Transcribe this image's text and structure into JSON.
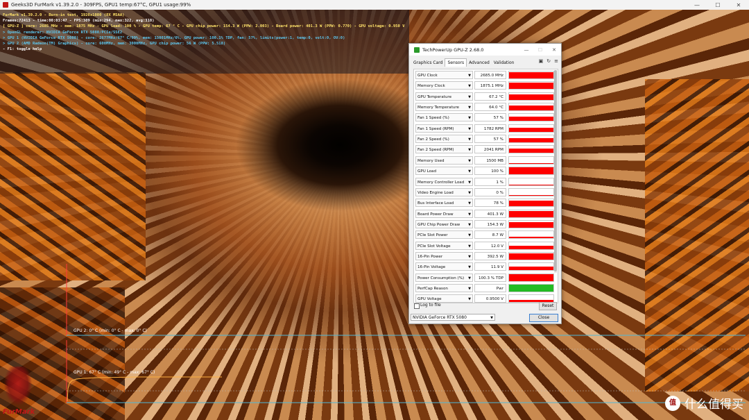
{
  "window": {
    "title": "Geeks3D FurMark v1.39.2.0 - 309FPS, GPU1 temp:67°C, GPU1 usage:99%",
    "min_glyph": "—",
    "max_glyph": "☐",
    "close_glyph": "✕"
  },
  "overlay": {
    "lines": [
      {
        "text": "FurMark v1.39.2.0 - Burn-in test, 1920x1080 (8X MSAA)",
        "color": "yellow"
      },
      {
        "text": "Frames:72413 - time:00:03:47 - FPS:309 (min:294, max:322, avg:318)",
        "color": "white"
      },
      {
        "text": "[ GPU-Z ] core: 2685 MHz - mem: 1875 MHz - GPU load: 100 % - GPU temp: 67 ° C - GPU chip power: 154.3 W (PPW: 2.003) - Board power: 401.3 W (PPW: 0.770) - GPU voltage: 0.950 V",
        "color": "yellow"
      },
      {
        "text": "> OpenGL renderer: NVIDIA GeForce RTX 5080/PCIe/SSE2",
        "color": "cyan"
      },
      {
        "text": "> GPU 1 (NVIDIA GeForce RTX 5080) - core: 2677MHz/67° C/99%, mem: 15001MHz/6%, GPU power: 100.1% TDP, fan: 57%, limits(power:1, temp:0, volt:0, OV:0)",
        "color": "cyan"
      },
      {
        "text": "> GPU 2 (AMD Radeon(TM) Graphics) - core: 600MHz, mem: 3000MHz, GPU chip power: 56 W (PPW: 5.518)",
        "color": "cyan"
      },
      {
        "text": "- F1: toggle help",
        "color": "white"
      }
    ]
  },
  "graphs": {
    "gpu2_label": "GPU 2: 0° C (min: 0° C - max: 0° C)",
    "gpu1_label": "GPU 1: 67° C (min: 49° C - max: 67° C)"
  },
  "gpuz": {
    "title": "TechPowerUp GPU-Z 2.68.0",
    "tabs": [
      "Graphics Card",
      "Sensors",
      "Advanced",
      "Validation"
    ],
    "active_tab": "Sensors",
    "icons": [
      "camera-icon",
      "refresh-icon",
      "menu-icon"
    ],
    "sensors": [
      {
        "name": "GPU Clock",
        "value": "2685.0 MHz",
        "fill": 0.85,
        "color": "#ff0000"
      },
      {
        "name": "Memory Clock",
        "value": "1875.1 MHz",
        "fill": 0.85,
        "color": "#ff0000"
      },
      {
        "name": "GPU Temperature",
        "value": "67.2 °C",
        "fill": 0.75,
        "color": "#ff0000"
      },
      {
        "name": "Memory Temperature",
        "value": "64.0 °C",
        "fill": 0.7,
        "color": "#ff0000"
      },
      {
        "name": "Fan 1 Speed (%)",
        "value": "57 %",
        "fill": 0.55,
        "color": "#ff0000"
      },
      {
        "name": "Fan 1 Speed (RPM)",
        "value": "1782 RPM",
        "fill": 0.55,
        "color": "#ff0000"
      },
      {
        "name": "Fan 2 Speed (%)",
        "value": "57 %",
        "fill": 0.55,
        "color": "#ff0000"
      },
      {
        "name": "Fan 2 Speed (RPM)",
        "value": "2041 RPM",
        "fill": 0.55,
        "color": "#ff0000"
      },
      {
        "name": "Memory Used",
        "value": "1500 MB",
        "fill": 0.12,
        "color": "#ff0000"
      },
      {
        "name": "GPU Load",
        "value": "100 %",
        "fill": 1.0,
        "color": "#ff0000"
      },
      {
        "name": "Memory Controller Load",
        "value": "1 %",
        "fill": 0.02,
        "color": "#ff0000"
      },
      {
        "name": "Video Engine Load",
        "value": "0 %",
        "fill": 0.0,
        "color": "#ff0000"
      },
      {
        "name": "Bus Interface Load",
        "value": "78 %",
        "fill": 0.78,
        "color": "#ff0000"
      },
      {
        "name": "Board Power Draw",
        "value": "401.3 W",
        "fill": 0.9,
        "color": "#ff0000"
      },
      {
        "name": "GPU Chip Power Draw",
        "value": "154.3 W",
        "fill": 0.8,
        "color": "#ff0000"
      },
      {
        "name": "PCIe Slot Power",
        "value": "8.7 W",
        "fill": 0.15,
        "color": "#ff0000"
      },
      {
        "name": "PCIe Slot Voltage",
        "value": "12.0 V",
        "fill": 0.5,
        "color": "#ff0000"
      },
      {
        "name": "16-Pin Power",
        "value": "392.5 W",
        "fill": 0.9,
        "color": "#ff0000"
      },
      {
        "name": "16-Pin Voltage",
        "value": "11.9 V",
        "fill": 0.5,
        "color": "#ff0000"
      },
      {
        "name": "Power Consumption (%)",
        "value": "100.3 % TDP",
        "fill": 1.0,
        "color": "#ff0000"
      },
      {
        "name": "PerfCap Reason",
        "value": "Pwr",
        "fill": 1.0,
        "color": "#22bb22"
      },
      {
        "name": "GPU Voltage",
        "value": "0.9500 V",
        "fill": 0.3,
        "color": "#ff0000"
      }
    ],
    "log_label": "Log to file",
    "reset_label": "Reset",
    "device": "NVIDIA GeForce RTX 5080",
    "close_label": "Close"
  },
  "furmark_logo": "FurMark",
  "watermark": {
    "badge": "值",
    "text": "什么值得买"
  }
}
